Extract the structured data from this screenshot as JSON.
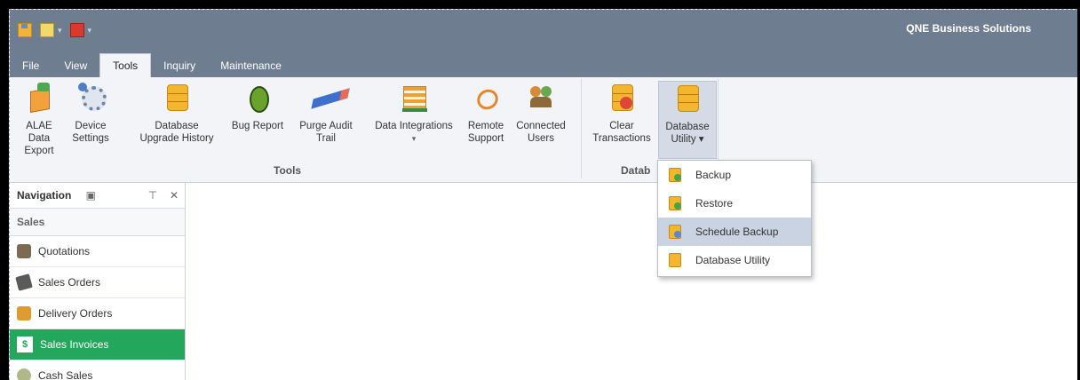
{
  "app": {
    "title": "QNE Business Solutions"
  },
  "quick_access": [
    {
      "icon": "save-icon"
    },
    {
      "icon": "clipboard-icon"
    },
    {
      "icon": "pdf-icon"
    }
  ],
  "menu_tabs": [
    {
      "label": "File"
    },
    {
      "label": "View"
    },
    {
      "label": "Tools",
      "active": true
    },
    {
      "label": "Inquiry"
    },
    {
      "label": "Maintenance"
    }
  ],
  "ribbon": {
    "tools_group_label": "Tools",
    "database_group_label": "Datab",
    "buttons": {
      "alae_export": {
        "line1": "ALAE Data",
        "line2": "Export",
        "icon": "box-export-icon"
      },
      "device_settings": {
        "line1": "Device",
        "line2": "Settings",
        "icon": "gear-icon"
      },
      "db_upgrade_history": {
        "line1": "Database",
        "line2": "Upgrade History",
        "icon": "database-icon"
      },
      "bug_report": {
        "line1": "Bug Report",
        "line2": "",
        "icon": "bug-icon"
      },
      "purge_audit": {
        "line1": "Purge Audit",
        "line2": "Trail",
        "icon": "eraser-icon"
      },
      "data_integrations": {
        "line1": "Data Integrations",
        "line2": "▾",
        "icon": "integration-icon"
      },
      "remote_support": {
        "line1": "Remote",
        "line2": "Support",
        "icon": "remote-support-icon"
      },
      "connected_users": {
        "line1": "Connected",
        "line2": "Users",
        "icon": "users-icon"
      },
      "clear_transactions": {
        "line1": "Clear",
        "line2": "Transactions",
        "icon": "database-delete-icon"
      },
      "database_utility": {
        "line1": "Database",
        "line2": "Utility ▾",
        "icon": "database-icon"
      }
    }
  },
  "database_utility_menu": [
    {
      "label": "Backup",
      "icon": "backup-icon"
    },
    {
      "label": "Restore",
      "icon": "restore-icon"
    },
    {
      "label": "Schedule Backup",
      "icon": "schedule-backup-icon",
      "hover": true
    },
    {
      "label": "Database Utility",
      "icon": "database-icon"
    }
  ],
  "navigation": {
    "title": "Navigation",
    "pin_glyph": "⊤",
    "close_glyph": "✕",
    "section": "Sales",
    "items": [
      {
        "label": "Quotations",
        "icon": "quotations-icon"
      },
      {
        "label": "Sales Orders",
        "icon": "sales-orders-icon"
      },
      {
        "label": "Delivery Orders",
        "icon": "delivery-orders-icon"
      },
      {
        "label": "Sales Invoices",
        "icon": "sales-invoices-icon",
        "active": true
      },
      {
        "label": "Cash Sales",
        "icon": "cash-sales-icon"
      }
    ]
  },
  "colors": {
    "title_bar": "#6f7d91",
    "ribbon_bg": "#f2f4f7",
    "nav_active": "#23a75c",
    "menu_hover": "#c9d3e1"
  }
}
